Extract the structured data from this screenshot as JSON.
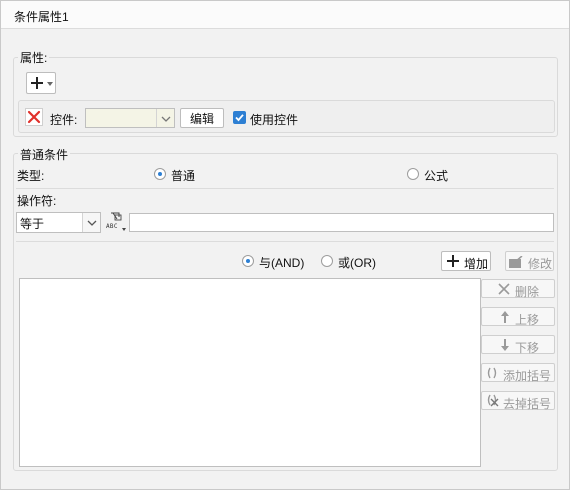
{
  "window": {
    "title": "条件属性1"
  },
  "properties": {
    "legend": "属性:",
    "add_button_glyph": "+",
    "control_label": "控件:",
    "control_select_value": "",
    "edit_button": "编辑",
    "use_control_label": "使用控件",
    "use_control_checked": true
  },
  "normal_condition": {
    "legend": "普通条件",
    "type_label": "类型:",
    "type_options": [
      {
        "label": "普通",
        "checked": true
      },
      {
        "label": "公式",
        "checked": false
      }
    ],
    "operator_label": "操作符:",
    "operator_value": "等于",
    "value_input": "",
    "formula_icon_text": "ABC"
  },
  "logic": {
    "options": [
      {
        "label": "与(AND)",
        "checked": true
      },
      {
        "label": "或(OR)",
        "checked": false
      }
    ],
    "add_button": "增加",
    "modify_button": "修改"
  },
  "list_actions": {
    "delete": "删除",
    "move_up": "上移",
    "move_down": "下移",
    "add_bracket": "添加括号",
    "remove_bracket": "去掉括号"
  },
  "colors": {
    "accent": "#2d7fd3",
    "delete_red": "#e0302a",
    "control_select_bg": "#f4f4e6"
  }
}
